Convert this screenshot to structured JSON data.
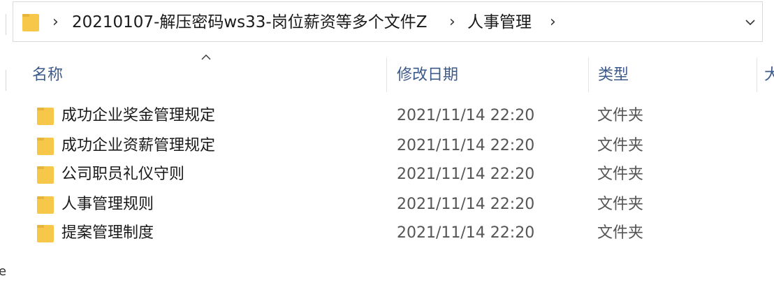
{
  "address_bar": {
    "breadcrumbs": [
      {
        "label": "20210107-解压密码ws33-岗位薪资等多个文件Z"
      },
      {
        "label": "人事管理"
      }
    ],
    "separator": "›"
  },
  "columns": {
    "name": "名称",
    "date_modified": "修改日期",
    "type": "类型",
    "size_partial": "大"
  },
  "rows": [
    {
      "name": "成功企业奖金管理规定",
      "date": "2021/11/14 22:20",
      "type": "文件夹"
    },
    {
      "name": "成功企业资薪管理规定",
      "date": "2021/11/14 22:20",
      "type": "文件夹"
    },
    {
      "name": "公司职员礼仪守则",
      "date": "2021/11/14 22:20",
      "type": "文件夹"
    },
    {
      "name": "人事管理规则",
      "date": "2021/11/14 22:20",
      "type": "文件夹"
    },
    {
      "name": "提案管理制度",
      "date": "2021/11/14 22:20",
      "type": "文件夹"
    }
  ],
  "left_gutter_text": "e",
  "colors": {
    "folder": "#f6c748",
    "folder_shade": "#e6b43a",
    "header_text": "#3c5a8a"
  }
}
